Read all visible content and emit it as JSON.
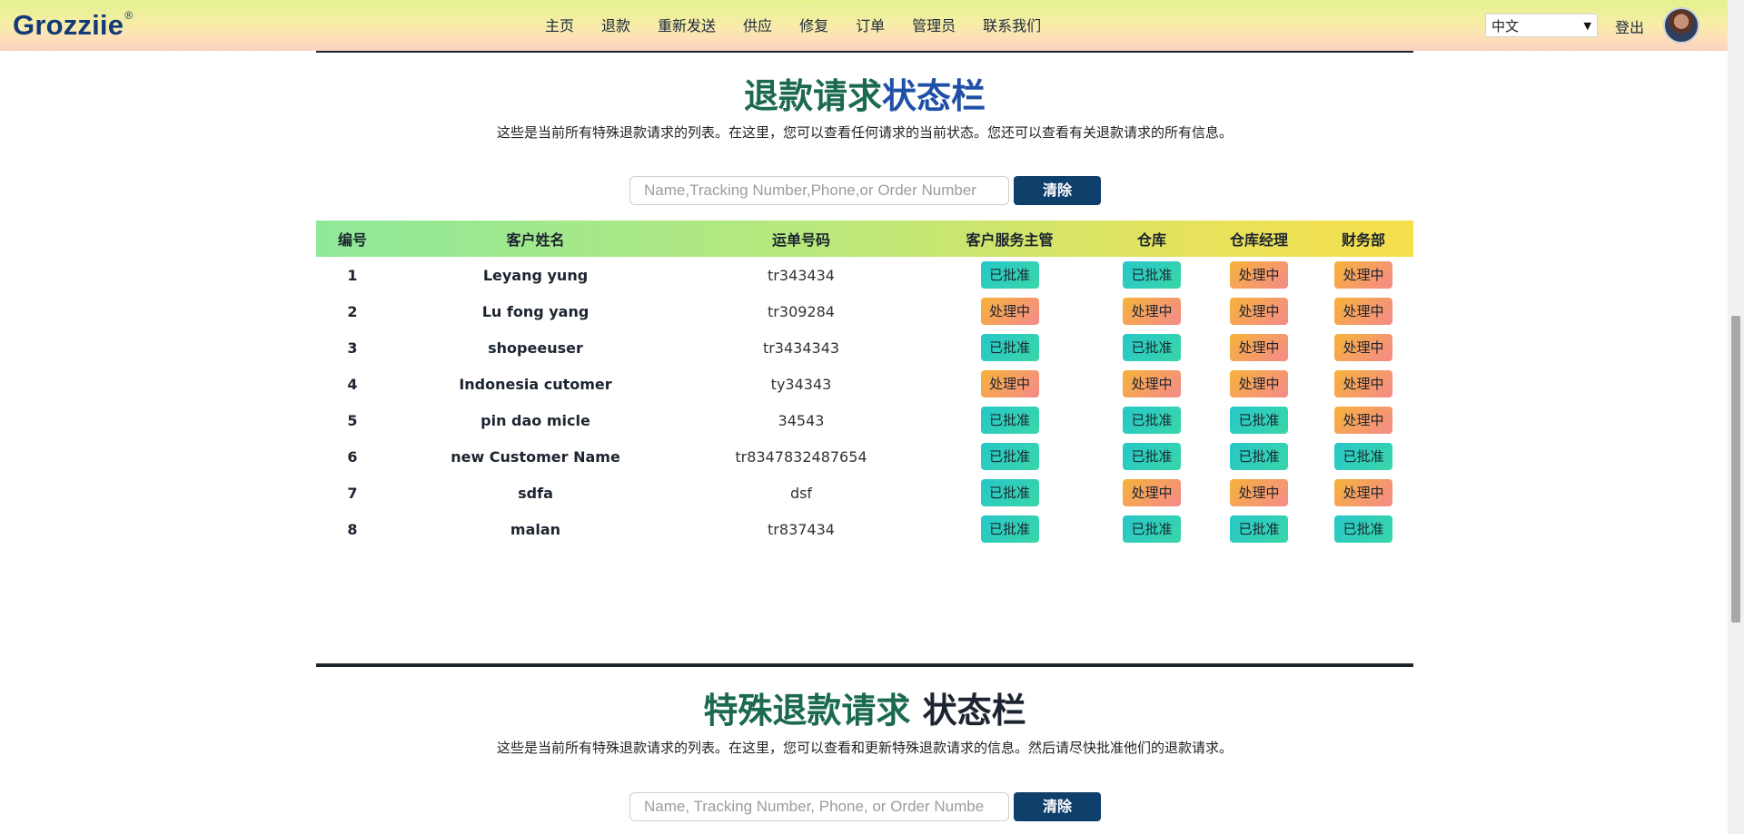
{
  "nav": {
    "logo": "Grozziie",
    "logo_mark": "®",
    "links": [
      "主页",
      "退款",
      "重新发送",
      "供应",
      "修复",
      "订单",
      "管理员",
      "联系我们"
    ],
    "language": "中文",
    "logout": "登出"
  },
  "section1": {
    "title_part1": "退款请求",
    "title_part2": "状态栏",
    "description": "这些是当前所有特殊退款请求的列表。在这里，您可以查看任何请求的当前状态。您还可以查看有关退款请求的所有信息。",
    "search_placeholder": "Name,Tracking Number,Phone,or Order Number",
    "clear_label": "清除",
    "table": {
      "headers": [
        "编号",
        "客户姓名",
        "运单号码",
        "客户服务主管",
        "仓库",
        "仓库经理",
        "财务部"
      ],
      "rows": [
        {
          "no": "1",
          "name": "Leyang yung",
          "tracking": "tr343434",
          "status": [
            "已批准",
            "已批准",
            "处理中",
            "处理中"
          ]
        },
        {
          "no": "2",
          "name": "Lu fong yang",
          "tracking": "tr309284",
          "status": [
            "处理中",
            "处理中",
            "处理中",
            "处理中"
          ]
        },
        {
          "no": "3",
          "name": "shopeeuser",
          "tracking": "tr3434343",
          "status": [
            "已批准",
            "已批准",
            "处理中",
            "处理中"
          ]
        },
        {
          "no": "4",
          "name": "Indonesia cutomer",
          "tracking": "ty34343",
          "status": [
            "处理中",
            "处理中",
            "处理中",
            "处理中"
          ]
        },
        {
          "no": "5",
          "name": "pin dao micle",
          "tracking": "34543",
          "status": [
            "已批准",
            "已批准",
            "已批准",
            "处理中"
          ]
        },
        {
          "no": "6",
          "name": "new Customer Name",
          "tracking": "tr8347832487654",
          "status": [
            "已批准",
            "已批准",
            "已批准",
            "已批准"
          ]
        },
        {
          "no": "7",
          "name": "sdfa",
          "tracking": "dsf",
          "status": [
            "已批准",
            "处理中",
            "处理中",
            "处理中"
          ]
        },
        {
          "no": "8",
          "name": "malan",
          "tracking": "tr837434",
          "status": [
            "已批准",
            "已批准",
            "已批准",
            "已批准"
          ]
        }
      ]
    }
  },
  "section2": {
    "title_part1": "特殊退款请求",
    "title_part2": "状态栏",
    "description": "这些是当前所有特殊退款请求的列表。在这里，您可以查看和更新特殊退款请求的信息。然后请尽快批准他们的退款请求。",
    "search_placeholder": "Name, Tracking Number, Phone, or Order Numbe",
    "clear_label": "清除"
  },
  "colors": {
    "approved": "#2ccfbd",
    "pending": "#f5a05a",
    "primary_button": "#0f3f6b",
    "title_green": "#1b6a4e",
    "title_blue": "#1f4fa6"
  },
  "icons": [
    "chevron-down-icon",
    "avatar"
  ]
}
